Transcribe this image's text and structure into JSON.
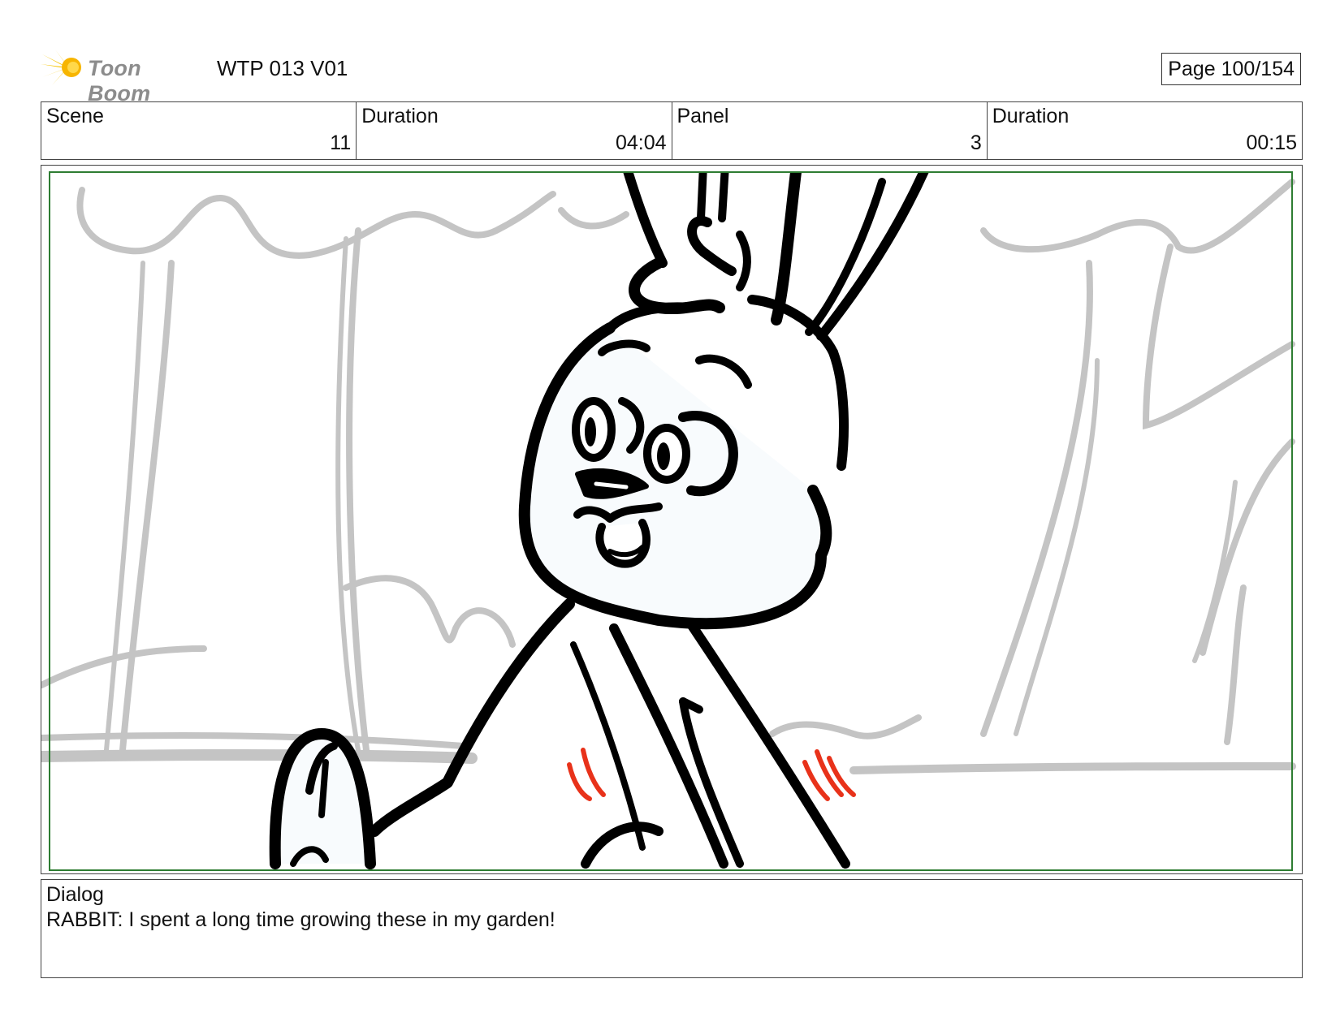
{
  "header": {
    "logo_text": "Toon Boom",
    "project_title": "WTP 013 V01",
    "page_label": "Page 100/154"
  },
  "info": {
    "scene_label": "Scene",
    "scene_value": "11",
    "scene_duration_label": "Duration",
    "scene_duration_value": "04:04",
    "panel_label": "Panel",
    "panel_value": "3",
    "panel_duration_label": "Duration",
    "panel_duration_value": "00:15"
  },
  "dialog": {
    "label": "Dialog",
    "text": "RABBIT: I spent a long time growing these in my garden!"
  },
  "colors": {
    "logo_star": "#f5c400",
    "safe_frame": "#2e7d32",
    "background_sketch": "#c4c4c4",
    "action_marks": "#e8321a"
  },
  "icons": {
    "logo": "toon-boom-star-logo"
  }
}
